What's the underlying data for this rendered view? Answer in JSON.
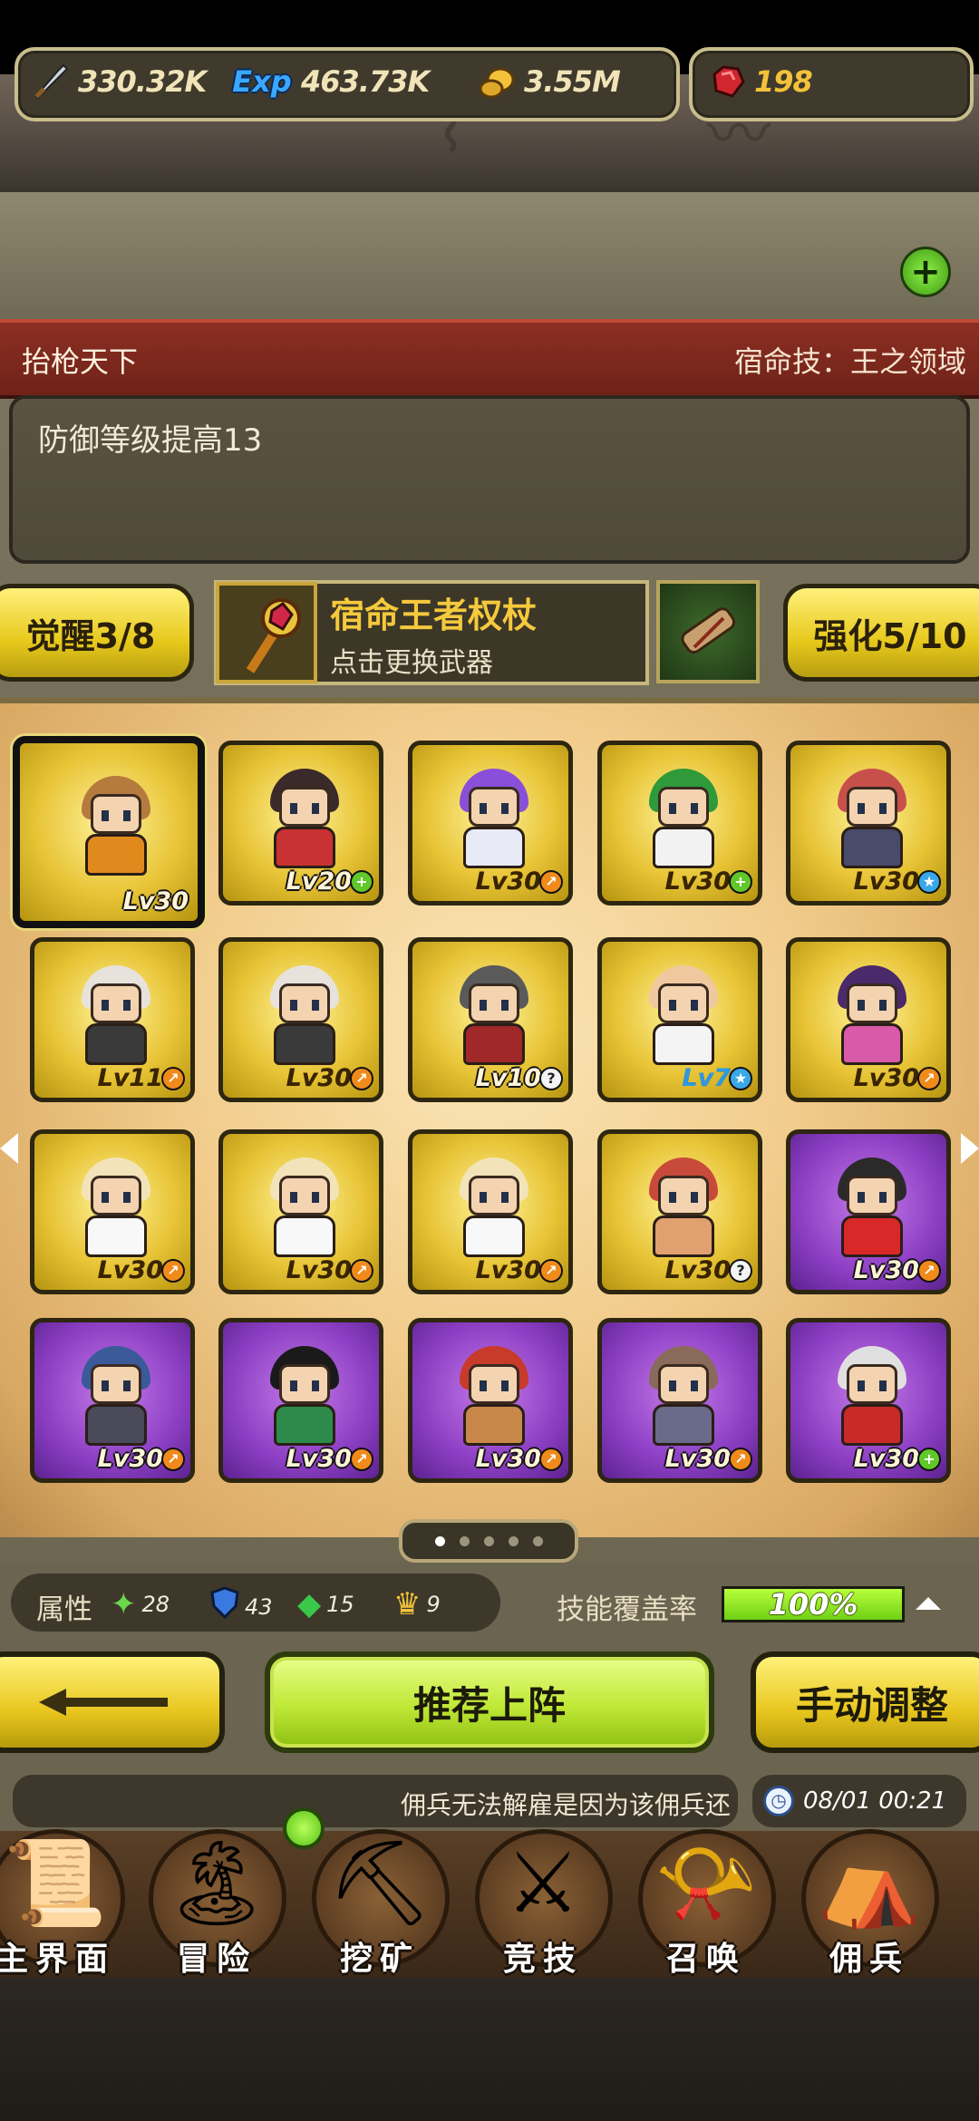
{
  "resources": [
    {
      "icon": "sword-icon",
      "glyph": "🗡",
      "value": "330.32K"
    },
    {
      "icon": "exp-icon",
      "glyph": "Exp",
      "value": "463.73K"
    },
    {
      "icon": "coin-icon",
      "glyph": "🪙",
      "value": "3.55M"
    },
    {
      "icon": "ruby-icon",
      "glyph": "♦",
      "value": "198"
    }
  ],
  "title_bar": {
    "left": "抬枪天下",
    "right": "宿命技：王之领域"
  },
  "description": "防御等级提高13",
  "awaken_button": "觉醒3/8",
  "enhance_button": "强化5/10",
  "weapon": {
    "name": "宿命王者权杖",
    "subtitle": "点击更换武器"
  },
  "heroes": [
    {
      "level": "Lv30",
      "frame": "gold",
      "badge": "",
      "selected": true,
      "hair": "#b57a3e",
      "body": "#e08a1e"
    },
    {
      "level": "Lv20",
      "frame": "gold",
      "badge": "+",
      "badge_color": "green",
      "hair": "#3a2a2a",
      "body": "#c83232"
    },
    {
      "level": "Lv30",
      "frame": "gold",
      "badge": "↗",
      "badge_color": "orange",
      "hair": "#8a4fd8",
      "body": "#e8eaf6"
    },
    {
      "level": "Lv30",
      "frame": "gold",
      "badge": "+",
      "badge_color": "green",
      "hair": "#2e9a3a",
      "body": "#f2f2f2"
    },
    {
      "level": "Lv30",
      "frame": "gold",
      "badge": "★",
      "badge_color": "blue",
      "hair": "#c8504a",
      "body": "#4a4a6a"
    },
    {
      "level": "Lv11",
      "frame": "gold",
      "badge": "↗",
      "badge_color": "orange",
      "hair": "#e8e2dc",
      "body": "#3a3a3a"
    },
    {
      "level": "Lv30",
      "frame": "gold",
      "badge": "↗",
      "badge_color": "orange",
      "hair": "#e8e2dc",
      "body": "#3a3a3a"
    },
    {
      "level": "Lv10",
      "frame": "gold",
      "badge": "?",
      "badge_color": "white",
      "hair": "#5a5a5a",
      "body": "#a02828"
    },
    {
      "level": "Lv7",
      "frame": "gold",
      "badge": "★",
      "badge_color": "blue",
      "hair": "#f0c8a0",
      "body": "#f4f4f4"
    },
    {
      "level": "Lv30",
      "frame": "gold",
      "badge": "↗",
      "badge_color": "orange",
      "hair": "#4a2a6a",
      "body": "#d85aa8"
    },
    {
      "level": "Lv30",
      "frame": "gold",
      "badge": "↗",
      "badge_color": "orange",
      "hair": "#f2e4b8",
      "body": "#f8f8f8"
    },
    {
      "level": "Lv30",
      "frame": "gold",
      "badge": "↗",
      "badge_color": "orange",
      "hair": "#f2e4b8",
      "body": "#f8f8f8"
    },
    {
      "level": "Lv30",
      "frame": "gold",
      "badge": "↗",
      "badge_color": "orange",
      "hair": "#f2e4b8",
      "body": "#f8f8f8"
    },
    {
      "level": "Lv30",
      "frame": "gold",
      "badge": "?",
      "badge_color": "white",
      "hair": "#c84a3a",
      "body": "#e0a070"
    },
    {
      "level": "Lv30",
      "frame": "purple",
      "badge": "↗",
      "badge_color": "orange",
      "hair": "#2a2a2a",
      "body": "#d82828"
    },
    {
      "level": "Lv30",
      "frame": "purple",
      "badge": "↗",
      "badge_color": "orange",
      "hair": "#3a5a9a",
      "body": "#4a4a5a"
    },
    {
      "level": "Lv30",
      "frame": "purple",
      "badge": "↗",
      "badge_color": "orange",
      "hair": "#1a1a1a",
      "body": "#2e8a4a"
    },
    {
      "level": "Lv30",
      "frame": "purple",
      "badge": "↗",
      "badge_color": "orange",
      "hair": "#c83a2a",
      "body": "#c8884a"
    },
    {
      "level": "Lv30",
      "frame": "purple",
      "badge": "↗",
      "badge_color": "orange",
      "hair": "#8a6a5a",
      "body": "#6a6a8a"
    },
    {
      "level": "Lv30",
      "frame": "purple",
      "badge": "+",
      "badge_color": "green",
      "hair": "#e0e0e0",
      "body": "#c82a2a"
    }
  ],
  "pager": {
    "pages": 5,
    "current": 1
  },
  "attributes": {
    "label": "属性",
    "items": [
      {
        "icon": "wind-blade-icon",
        "glyph": "✦",
        "value": "28"
      },
      {
        "icon": "shield-icon",
        "glyph": "🛡",
        "value": "43"
      },
      {
        "icon": "green-gem-icon",
        "glyph": "◆",
        "value": "15"
      },
      {
        "icon": "crown-icon",
        "glyph": "♛",
        "value": "9"
      }
    ]
  },
  "skill_coverage": {
    "label": "技能覆盖率",
    "value": "100%",
    "fraction": 1.0
  },
  "actions": {
    "recommend": "推荐上阵",
    "manual": "手动调整"
  },
  "notice": "佣兵无法解雇是因为该佣兵还",
  "clock_time": "08/01 00:21",
  "nav": [
    {
      "id": "home",
      "label": "主界面",
      "glyph": "📜"
    },
    {
      "id": "adventure",
      "label": "冒险",
      "glyph": "🏝"
    },
    {
      "id": "mining",
      "label": "挖矿",
      "glyph": "⛏"
    },
    {
      "id": "arena",
      "label": "竞技",
      "glyph": "⚔"
    },
    {
      "id": "summon",
      "label": "召唤",
      "glyph": "📯"
    },
    {
      "id": "mercenary",
      "label": "佣兵",
      "glyph": "⛺"
    }
  ],
  "colors": {
    "accent_yellow": "#e8c61e",
    "accent_green": "#bfe836",
    "title_red": "#8c2f22"
  }
}
